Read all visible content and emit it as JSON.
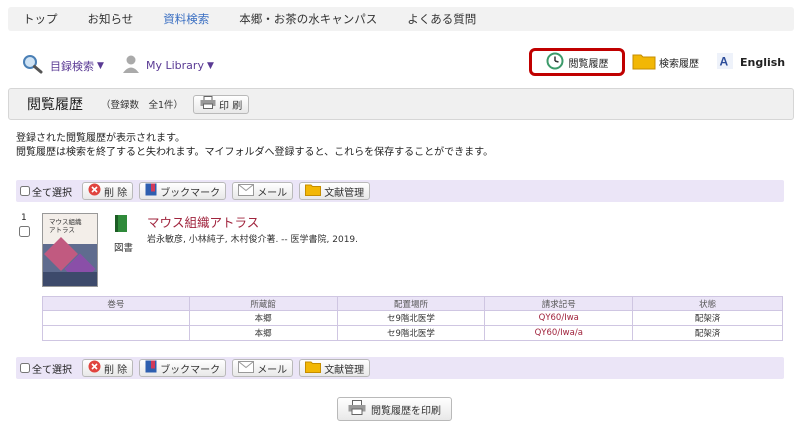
{
  "nav": {
    "items": [
      {
        "label": "トップ"
      },
      {
        "label": "お知らせ"
      },
      {
        "label": "資料検索"
      },
      {
        "label": "本郷・お茶の水キャンパス"
      },
      {
        "label": "よくある質問"
      }
    ]
  },
  "toolbar": {
    "catalog_search": "目録検索",
    "my_library": "My Library",
    "browse_history": "閲覧履歴",
    "search_history": "検索履歴",
    "english": "English"
  },
  "header": {
    "title": "閲覧履歴",
    "count": "（登録数　全1件）",
    "print_label": "印 刷"
  },
  "description": {
    "line1": "登録された閲覧履歴が表示されます。",
    "line2": "閲覧履歴は検索を終了すると失われます。マイフォルダへ登録すると、これらを保存することができます。"
  },
  "actions": {
    "select_all": "全て選択",
    "delete": "削 除",
    "bookmark": "ブックマーク",
    "mail": "メール",
    "reference": "文献管理"
  },
  "record": {
    "number": "1",
    "title": "マウス組織アトラス",
    "meta": "岩永敏彦, 小林純子, 木村俊介著. -- 医学書院, 2019.",
    "type_label": "図書",
    "cover_title_line1": "マウス組織",
    "cover_title_line2": "アトラス"
  },
  "holdings": {
    "columns": [
      "巻号",
      "所蔵館",
      "配置場所",
      "請求記号",
      "状態"
    ],
    "rows": [
      [
        "",
        "本郷",
        "セ9階北医学",
        "QY60/Iwa",
        "配架済"
      ],
      [
        "",
        "本郷",
        "セ9階北医学",
        "QY60/Iwa/a",
        "配架済"
      ]
    ]
  },
  "footer": {
    "print_history": "閲覧履歴を印刷"
  },
  "colors": {
    "accent_red": "#c00000",
    "link_purple": "#5a3a94",
    "title_red": "#a0243d",
    "bar_lavender": "#ebe5f7"
  }
}
